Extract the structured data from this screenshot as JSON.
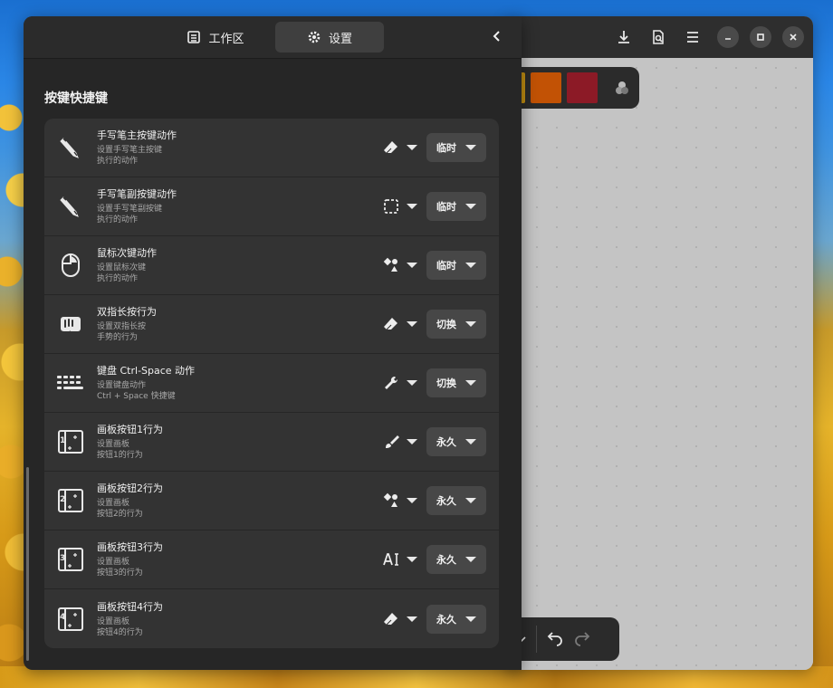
{
  "sidebar": {
    "tabs": [
      {
        "label": "工作区",
        "icon": "document-icon"
      },
      {
        "label": "设置",
        "icon": "gear-icon"
      }
    ],
    "section_title": "按键快捷键",
    "rows": [
      {
        "title": "手写笔主按键动作",
        "sub1": "设置手写笔主按键",
        "sub2": "执行的动作",
        "icon": "stylus-icon",
        "tool_icon": "eraser-icon",
        "mode": "临时"
      },
      {
        "title": "手写笔副按键动作",
        "sub1": "设置手写笔副按键",
        "sub2": "执行的动作",
        "icon": "stylus-icon",
        "tool_icon": "selection-icon",
        "mode": "临时"
      },
      {
        "title": "鼠标次键动作",
        "sub1": "设置鼠标次键",
        "sub2": "执行的动作",
        "icon": "mouse-icon",
        "tool_icon": "shapes-icon",
        "mode": "临时"
      },
      {
        "title": "双指长按行为",
        "sub1": "设置双指长按",
        "sub2": "手势的行为",
        "icon": "touch-gesture-icon",
        "tool_icon": "eraser-icon",
        "mode": "切换"
      },
      {
        "title": "键盘 Ctrl-Space 动作",
        "sub1": "设置键盘动作",
        "sub2": "Ctrl + Space 快捷键",
        "icon": "keyboard-icon",
        "tool_icon": "wrench-icon",
        "mode": "切换"
      },
      {
        "title": "画板按钮1行为",
        "sub1": "设置画板",
        "sub2": "按钮1的行为",
        "icon": "tablet-button-icon",
        "badge": "1",
        "tool_icon": "brush-icon",
        "mode": "永久"
      },
      {
        "title": "画板按钮2行为",
        "sub1": "设置画板",
        "sub2": "按钮2的行为",
        "icon": "tablet-button-icon",
        "badge": "2",
        "tool_icon": "shapes-icon",
        "mode": "永久"
      },
      {
        "title": "画板按钮3行为",
        "sub1": "设置画板",
        "sub2": "按钮3的行为",
        "icon": "tablet-button-icon",
        "badge": "3",
        "tool_icon": "text-tool-icon",
        "mode": "永久"
      },
      {
        "title": "画板按钮4行为",
        "sub1": "设置画板",
        "sub2": "按钮4的行为",
        "icon": "tablet-button-icon",
        "badge": "4",
        "tool_icon": "eraser-icon",
        "mode": "永久"
      }
    ]
  },
  "app": {
    "header_icons": [
      "download-icon",
      "export-page-icon",
      "menu-icon"
    ],
    "window_controls": [
      "minimize-icon",
      "maximize-icon",
      "close-icon"
    ],
    "palette_colors": [
      "#c49012",
      "#c25205",
      "#8c1a26"
    ],
    "palette_icon": "color-picker-icon",
    "bottom_toolbar_icons": [
      "chevron-down-icon",
      "undo-icon",
      "redo-icon"
    ]
  },
  "colors": {
    "sidebar_bg": "#262626",
    "row_bg": "#333333",
    "dropdown_bg": "#474747",
    "canvas_bg": "#c4c4c4"
  }
}
